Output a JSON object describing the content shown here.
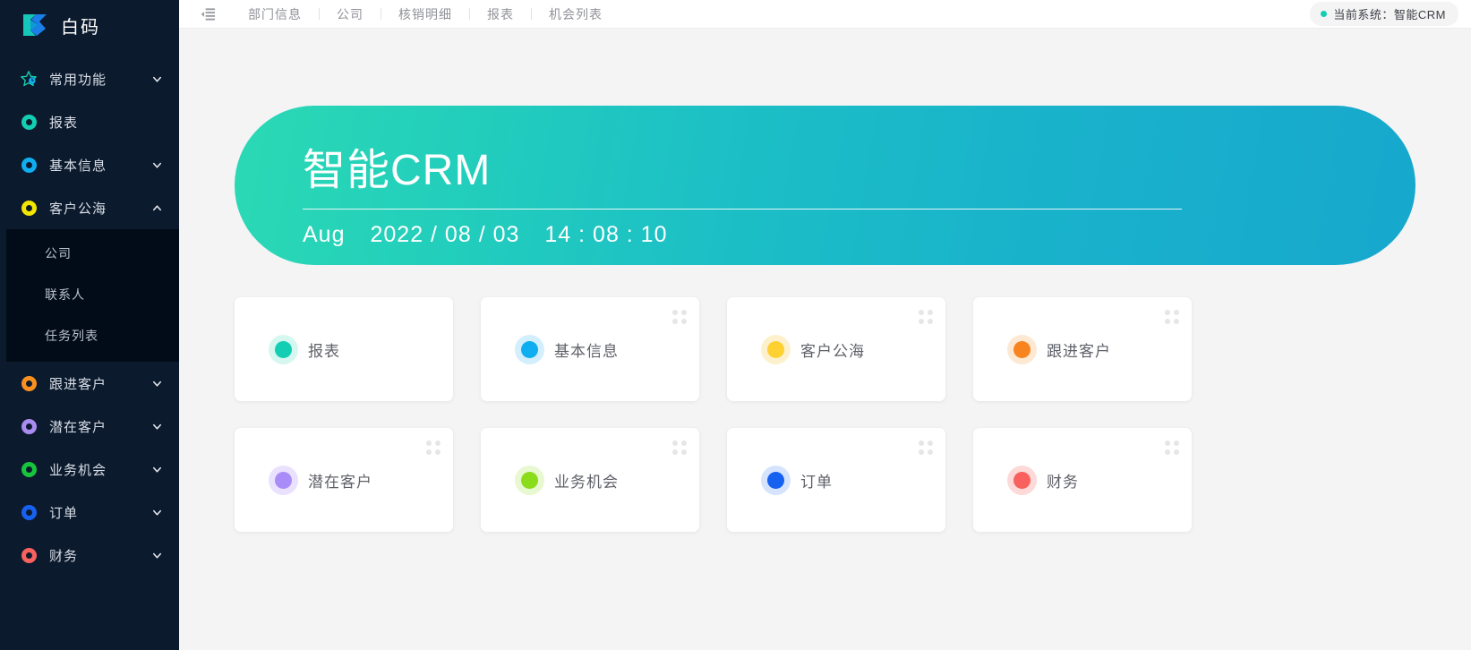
{
  "brand": {
    "name": "白码",
    "logo_icon": "bm-logo-icon"
  },
  "colors": {
    "sidebar_bg": "#0c1a2d",
    "submenu_bg": "#020b18",
    "accent_teal": "#13ceb2",
    "accent_blue": "#17a8cd",
    "page_bg": "#f4f4f5",
    "hero_from": "#2bd9b4",
    "hero_to": "#17a8cd"
  },
  "sidebar": {
    "items": [
      {
        "label": "常用功能",
        "icon": "star-clock-icon",
        "color": "#16cfae",
        "expandable": true,
        "expanded": false
      },
      {
        "label": "报表",
        "icon": "ring-icon",
        "color": "#13ceb2",
        "expandable": false,
        "expanded": false
      },
      {
        "label": "基本信息",
        "icon": "ring-icon",
        "color": "#0faef0",
        "expandable": true,
        "expanded": false
      },
      {
        "label": "客户公海",
        "icon": "ring-icon",
        "color": "#f2e500",
        "expandable": true,
        "expanded": true,
        "children": [
          {
            "label": "公司"
          },
          {
            "label": "联系人"
          },
          {
            "label": "任务列表"
          }
        ]
      },
      {
        "label": "跟进客户",
        "icon": "ring-icon",
        "color": "#f89020",
        "expandable": true,
        "expanded": false
      },
      {
        "label": "潜在客户",
        "icon": "ring-icon",
        "color": "#a98cf0",
        "expandable": true,
        "expanded": false
      },
      {
        "label": "业务机会",
        "icon": "ring-icon",
        "color": "#16c53c",
        "expandable": true,
        "expanded": false
      },
      {
        "label": "订单",
        "icon": "ring-icon",
        "color": "#1761f0",
        "expandable": true,
        "expanded": false
      },
      {
        "label": "财务",
        "icon": "ring-icon",
        "color": "#f8615e",
        "expandable": true,
        "expanded": false
      }
    ]
  },
  "topbar": {
    "collapse_icon": "indent-collapse-icon",
    "tabs": [
      {
        "label": "部门信息"
      },
      {
        "label": "公司"
      },
      {
        "label": "核销明细"
      },
      {
        "label": "报表"
      },
      {
        "label": "机会列表"
      }
    ],
    "system_badge": {
      "dot_icon": "status-dot-icon",
      "text": "当前系统：智能CRM"
    }
  },
  "hero": {
    "title": "智能CRM",
    "month": "Aug",
    "date": "2022 / 08 / 03",
    "time": "14 : 08 : 10"
  },
  "cards": [
    {
      "label": "报表",
      "color": "#13ceb2",
      "halo": "#d6f7f0",
      "grip": false,
      "grip_icon": "drag-grip-icon"
    },
    {
      "label": "基本信息",
      "color": "#0faef0",
      "halo": "#d3eefd",
      "grip": true,
      "grip_icon": "drag-grip-icon"
    },
    {
      "label": "客户公海",
      "color": "#fdd131",
      "halo": "#fdf1cd",
      "grip": true,
      "grip_icon": "drag-grip-icon"
    },
    {
      "label": "跟进客户",
      "color": "#f8841f",
      "halo": "#fde8d3",
      "grip": true,
      "grip_icon": "drag-grip-icon"
    },
    {
      "label": "潜在客户",
      "color": "#a98cf8",
      "halo": "#e9e1fd",
      "grip": true,
      "grip_icon": "drag-grip-icon"
    },
    {
      "label": "业务机会",
      "color": "#8bdc1b",
      "halo": "#e8f8d0",
      "grip": true,
      "grip_icon": "drag-grip-icon"
    },
    {
      "label": "订单",
      "color": "#1761f0",
      "halo": "#d5e3fd",
      "grip": true,
      "grip_icon": "drag-grip-icon"
    },
    {
      "label": "财务",
      "color": "#f8615e",
      "halo": "#fdd9d8",
      "grip": true,
      "grip_icon": "drag-grip-icon"
    }
  ]
}
